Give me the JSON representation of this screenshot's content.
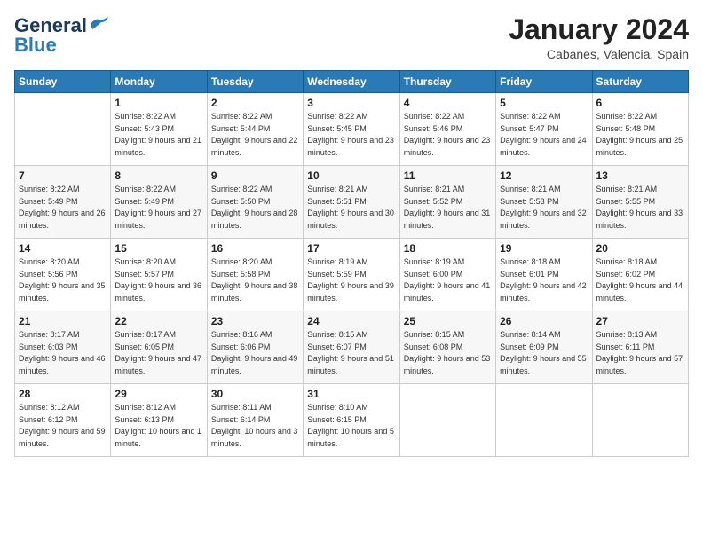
{
  "logo": {
    "line1": "General",
    "line2": "Blue"
  },
  "title": "January 2024",
  "location": "Cabanes, Valencia, Spain",
  "weekdays": [
    "Sunday",
    "Monday",
    "Tuesday",
    "Wednesday",
    "Thursday",
    "Friday",
    "Saturday"
  ],
  "weeks": [
    [
      {
        "day": "",
        "sunrise": "",
        "sunset": "",
        "daylight": ""
      },
      {
        "day": "1",
        "sunrise": "Sunrise: 8:22 AM",
        "sunset": "Sunset: 5:43 PM",
        "daylight": "Daylight: 9 hours and 21 minutes."
      },
      {
        "day": "2",
        "sunrise": "Sunrise: 8:22 AM",
        "sunset": "Sunset: 5:44 PM",
        "daylight": "Daylight: 9 hours and 22 minutes."
      },
      {
        "day": "3",
        "sunrise": "Sunrise: 8:22 AM",
        "sunset": "Sunset: 5:45 PM",
        "daylight": "Daylight: 9 hours and 23 minutes."
      },
      {
        "day": "4",
        "sunrise": "Sunrise: 8:22 AM",
        "sunset": "Sunset: 5:46 PM",
        "daylight": "Daylight: 9 hours and 23 minutes."
      },
      {
        "day": "5",
        "sunrise": "Sunrise: 8:22 AM",
        "sunset": "Sunset: 5:47 PM",
        "daylight": "Daylight: 9 hours and 24 minutes."
      },
      {
        "day": "6",
        "sunrise": "Sunrise: 8:22 AM",
        "sunset": "Sunset: 5:48 PM",
        "daylight": "Daylight: 9 hours and 25 minutes."
      }
    ],
    [
      {
        "day": "7",
        "sunrise": "Sunrise: 8:22 AM",
        "sunset": "Sunset: 5:49 PM",
        "daylight": "Daylight: 9 hours and 26 minutes."
      },
      {
        "day": "8",
        "sunrise": "Sunrise: 8:22 AM",
        "sunset": "Sunset: 5:49 PM",
        "daylight": "Daylight: 9 hours and 27 minutes."
      },
      {
        "day": "9",
        "sunrise": "Sunrise: 8:22 AM",
        "sunset": "Sunset: 5:50 PM",
        "daylight": "Daylight: 9 hours and 28 minutes."
      },
      {
        "day": "10",
        "sunrise": "Sunrise: 8:21 AM",
        "sunset": "Sunset: 5:51 PM",
        "daylight": "Daylight: 9 hours and 30 minutes."
      },
      {
        "day": "11",
        "sunrise": "Sunrise: 8:21 AM",
        "sunset": "Sunset: 5:52 PM",
        "daylight": "Daylight: 9 hours and 31 minutes."
      },
      {
        "day": "12",
        "sunrise": "Sunrise: 8:21 AM",
        "sunset": "Sunset: 5:53 PM",
        "daylight": "Daylight: 9 hours and 32 minutes."
      },
      {
        "day": "13",
        "sunrise": "Sunrise: 8:21 AM",
        "sunset": "Sunset: 5:55 PM",
        "daylight": "Daylight: 9 hours and 33 minutes."
      }
    ],
    [
      {
        "day": "14",
        "sunrise": "Sunrise: 8:20 AM",
        "sunset": "Sunset: 5:56 PM",
        "daylight": "Daylight: 9 hours and 35 minutes."
      },
      {
        "day": "15",
        "sunrise": "Sunrise: 8:20 AM",
        "sunset": "Sunset: 5:57 PM",
        "daylight": "Daylight: 9 hours and 36 minutes."
      },
      {
        "day": "16",
        "sunrise": "Sunrise: 8:20 AM",
        "sunset": "Sunset: 5:58 PM",
        "daylight": "Daylight: 9 hours and 38 minutes."
      },
      {
        "day": "17",
        "sunrise": "Sunrise: 8:19 AM",
        "sunset": "Sunset: 5:59 PM",
        "daylight": "Daylight: 9 hours and 39 minutes."
      },
      {
        "day": "18",
        "sunrise": "Sunrise: 8:19 AM",
        "sunset": "Sunset: 6:00 PM",
        "daylight": "Daylight: 9 hours and 41 minutes."
      },
      {
        "day": "19",
        "sunrise": "Sunrise: 8:18 AM",
        "sunset": "Sunset: 6:01 PM",
        "daylight": "Daylight: 9 hours and 42 minutes."
      },
      {
        "day": "20",
        "sunrise": "Sunrise: 8:18 AM",
        "sunset": "Sunset: 6:02 PM",
        "daylight": "Daylight: 9 hours and 44 minutes."
      }
    ],
    [
      {
        "day": "21",
        "sunrise": "Sunrise: 8:17 AM",
        "sunset": "Sunset: 6:03 PM",
        "daylight": "Daylight: 9 hours and 46 minutes."
      },
      {
        "day": "22",
        "sunrise": "Sunrise: 8:17 AM",
        "sunset": "Sunset: 6:05 PM",
        "daylight": "Daylight: 9 hours and 47 minutes."
      },
      {
        "day": "23",
        "sunrise": "Sunrise: 8:16 AM",
        "sunset": "Sunset: 6:06 PM",
        "daylight": "Daylight: 9 hours and 49 minutes."
      },
      {
        "day": "24",
        "sunrise": "Sunrise: 8:15 AM",
        "sunset": "Sunset: 6:07 PM",
        "daylight": "Daylight: 9 hours and 51 minutes."
      },
      {
        "day": "25",
        "sunrise": "Sunrise: 8:15 AM",
        "sunset": "Sunset: 6:08 PM",
        "daylight": "Daylight: 9 hours and 53 minutes."
      },
      {
        "day": "26",
        "sunrise": "Sunrise: 8:14 AM",
        "sunset": "Sunset: 6:09 PM",
        "daylight": "Daylight: 9 hours and 55 minutes."
      },
      {
        "day": "27",
        "sunrise": "Sunrise: 8:13 AM",
        "sunset": "Sunset: 6:11 PM",
        "daylight": "Daylight: 9 hours and 57 minutes."
      }
    ],
    [
      {
        "day": "28",
        "sunrise": "Sunrise: 8:12 AM",
        "sunset": "Sunset: 6:12 PM",
        "daylight": "Daylight: 9 hours and 59 minutes."
      },
      {
        "day": "29",
        "sunrise": "Sunrise: 8:12 AM",
        "sunset": "Sunset: 6:13 PM",
        "daylight": "Daylight: 10 hours and 1 minute."
      },
      {
        "day": "30",
        "sunrise": "Sunrise: 8:11 AM",
        "sunset": "Sunset: 6:14 PM",
        "daylight": "Daylight: 10 hours and 3 minutes."
      },
      {
        "day": "31",
        "sunrise": "Sunrise: 8:10 AM",
        "sunset": "Sunset: 6:15 PM",
        "daylight": "Daylight: 10 hours and 5 minutes."
      },
      {
        "day": "",
        "sunrise": "",
        "sunset": "",
        "daylight": ""
      },
      {
        "day": "",
        "sunrise": "",
        "sunset": "",
        "daylight": ""
      },
      {
        "day": "",
        "sunrise": "",
        "sunset": "",
        "daylight": ""
      }
    ]
  ]
}
